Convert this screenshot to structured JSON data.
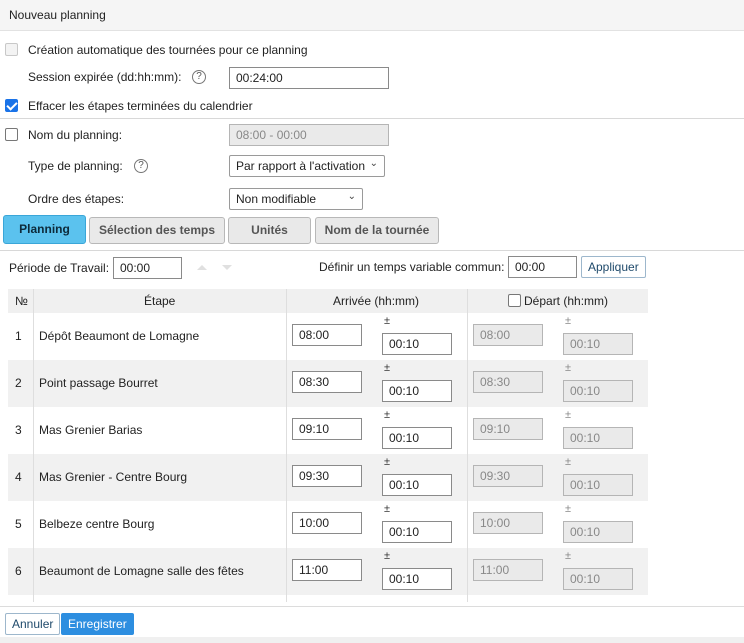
{
  "header": {
    "title": "Nouveau planning"
  },
  "options": {
    "auto_creation_label": "Création automatique des tournées pour ce planning",
    "session_label": "Session expirée (dd:hh:mm):",
    "session_help": "?",
    "session_value": "00:24:00",
    "erase_steps_label": "Effacer les étapes terminées du calendrier",
    "name_label": "Nom du planning:",
    "name_value": "08:00 - 00:00",
    "type_label": "Type de planning:",
    "type_help": "?",
    "type_value": "Par rapport à l'activation",
    "order_label": "Ordre des étapes:",
    "order_value": "Non modifiable"
  },
  "tabs": [
    {
      "label": "Planning"
    },
    {
      "label": "Sélection des temps"
    },
    {
      "label": "Unités"
    },
    {
      "label": "Nom de la tournée"
    }
  ],
  "work": {
    "period_label": "Période de Travail:",
    "period_value": "00:00",
    "common_label": "Définir un temps variable commun:",
    "common_value": "00:00",
    "apply_label": "Appliquer"
  },
  "table": {
    "columns": {
      "num": "№",
      "step": "Étape",
      "arrival": "Arrivée (hh:mm)",
      "departure": "Départ (hh:mm)"
    },
    "pm": "±",
    "rows": [
      {
        "num": "1",
        "step": "Dépôt Beaumont de Lomagne",
        "arrival": "08:00",
        "arrival_var": "00:10",
        "departure": "08:00",
        "departure_var": "00:10"
      },
      {
        "num": "2",
        "step": "Point passage Bourret",
        "arrival": "08:30",
        "arrival_var": "00:10",
        "departure": "08:30",
        "departure_var": "00:10"
      },
      {
        "num": "3",
        "step": "Mas Grenier Barias",
        "arrival": "09:10",
        "arrival_var": "00:10",
        "departure": "09:10",
        "departure_var": "00:10"
      },
      {
        "num": "4",
        "step": "Mas Grenier - Centre Bourg",
        "arrival": "09:30",
        "arrival_var": "00:10",
        "departure": "09:30",
        "departure_var": "00:10"
      },
      {
        "num": "5",
        "step": "Belbeze centre Bourg",
        "arrival": "10:00",
        "arrival_var": "00:10",
        "departure": "10:00",
        "departure_var": "00:10"
      },
      {
        "num": "6",
        "step": "Beaumont de Lomagne salle des fêtes",
        "arrival": "11:00",
        "arrival_var": "00:10",
        "departure": "11:00",
        "departure_var": "00:10"
      }
    ]
  },
  "footer": {
    "cancel_label": "Annuler",
    "save_label": "Enregistrer"
  }
}
